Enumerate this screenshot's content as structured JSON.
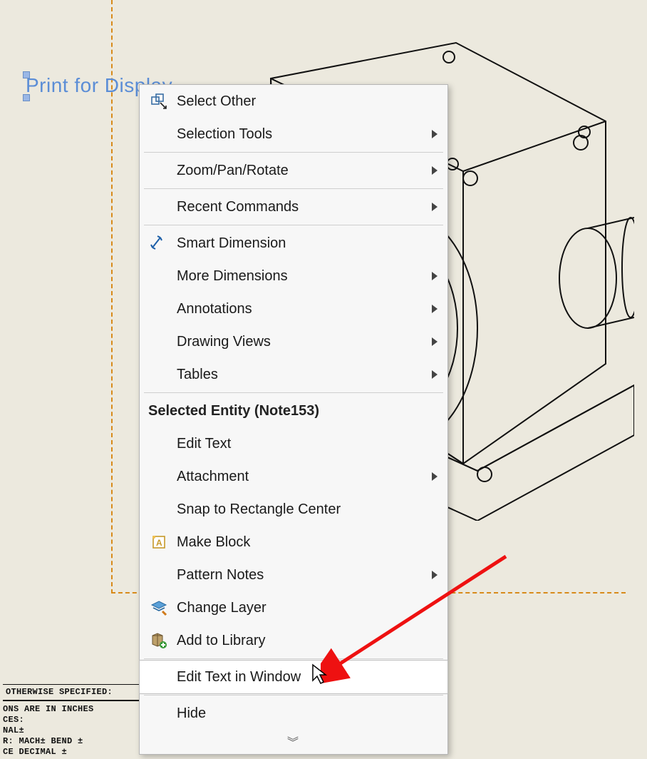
{
  "note": {
    "text": "Print for Display"
  },
  "menu": {
    "items": [
      {
        "label": "Select Other",
        "icon": "select-other"
      },
      {
        "label": "Selection Tools",
        "submenu": true
      },
      {
        "sep": true
      },
      {
        "label": "Zoom/Pan/Rotate",
        "submenu": true
      },
      {
        "sep": true
      },
      {
        "label": "Recent Commands",
        "submenu": true
      },
      {
        "sep": true
      },
      {
        "label": "Smart Dimension",
        "icon": "smart-dim"
      },
      {
        "label": "More Dimensions",
        "submenu": true
      },
      {
        "label": "Annotations",
        "submenu": true
      },
      {
        "label": "Drawing Views",
        "submenu": true
      },
      {
        "label": "Tables",
        "submenu": true
      }
    ],
    "header": "Selected Entity (Note153)",
    "entity_items": [
      {
        "label": "Edit Text"
      },
      {
        "label": "Attachment",
        "submenu": true
      },
      {
        "label": "Snap to Rectangle Center"
      },
      {
        "label": "Make Block",
        "icon": "make-block"
      },
      {
        "label": "Pattern Notes",
        "submenu": true
      },
      {
        "label": "Change Layer",
        "icon": "change-layer"
      },
      {
        "label": "Add to Library",
        "icon": "add-lib"
      },
      {
        "sep": true
      },
      {
        "label": "Edit Text in Window",
        "hover": true
      },
      {
        "sep": true
      },
      {
        "label": "Hide"
      }
    ],
    "expand_glyph": "︾"
  },
  "title_block": {
    "header": "OTHERWISE SPECIFIED:",
    "lines": [
      "ONS ARE IN INCHES",
      "CES:",
      "NAL±",
      "R: MACH±   BEND ±",
      "CE DECIMAL  ±"
    ]
  }
}
